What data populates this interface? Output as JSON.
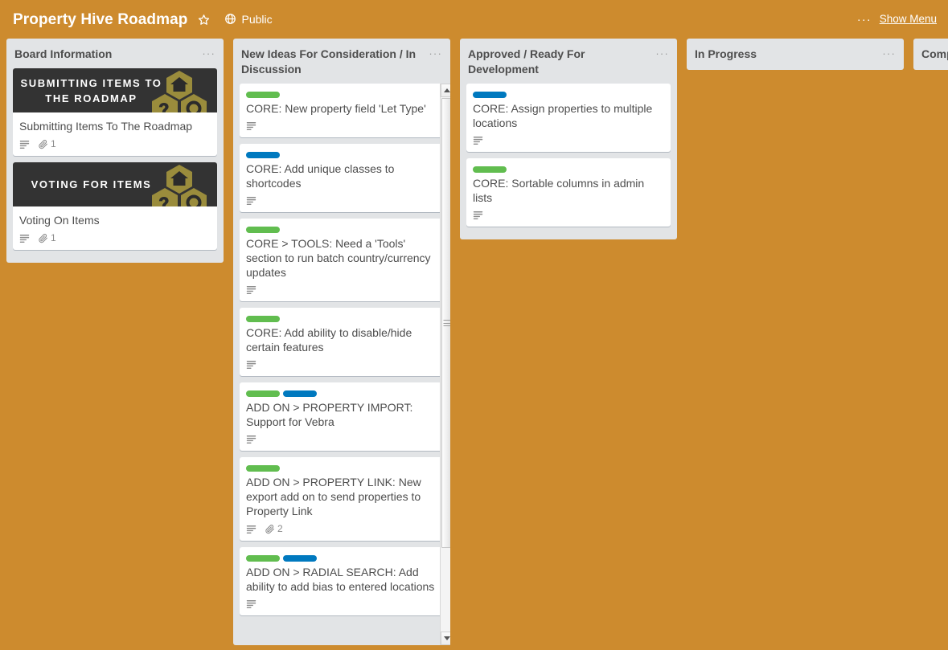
{
  "header": {
    "board_title": "Property Hive Roadmap",
    "star_icon": "star-icon",
    "visibility_icon": "globe-icon",
    "visibility_label": "Public",
    "more_dots": "···",
    "show_menu_label": "Show Menu"
  },
  "colors": {
    "board_background": "#cd8b2e",
    "list_background": "#e2e4e6",
    "card_background": "#ffffff",
    "label_green": "#61bd4f",
    "label_blue": "#0079bf",
    "cover_background": "#333333",
    "logo_gold": "#9a8c3c",
    "text_primary": "#4d4d4d"
  },
  "lists": [
    {
      "title": "Board Information",
      "menu_dots": "···",
      "scrollable": false,
      "cards": [
        {
          "cover": {
            "text": "SUBMITTING ITEMS TO THE ROADMAP",
            "logo": "property-hive-hex-logo"
          },
          "labels": [],
          "title": "Submitting Items To The Roadmap",
          "badges": {
            "description": true,
            "attachments": "1"
          }
        },
        {
          "cover": {
            "text": "VOTING FOR ITEMS",
            "logo": "property-hive-hex-logo"
          },
          "labels": [],
          "title": "Voting On Items",
          "badges": {
            "description": true,
            "attachments": "1"
          }
        }
      ]
    },
    {
      "title": "New Ideas For Consideration / In Discussion",
      "menu_dots": "···",
      "scrollable": true,
      "cards": [
        {
          "labels": [
            "green"
          ],
          "title": "CORE: New property field 'Let Type'",
          "badges": {
            "description": true,
            "attachments": null
          }
        },
        {
          "labels": [
            "blue"
          ],
          "title": "CORE: Add unique classes to shortcodes",
          "badges": {
            "description": true,
            "attachments": null
          }
        },
        {
          "labels": [
            "green"
          ],
          "title": "CORE > TOOLS: Need a 'Tools' section to run batch country/currency updates",
          "badges": {
            "description": true,
            "attachments": null
          }
        },
        {
          "labels": [
            "green"
          ],
          "title": "CORE: Add ability to disable/hide certain features",
          "badges": {
            "description": true,
            "attachments": null
          }
        },
        {
          "labels": [
            "green",
            "blue"
          ],
          "title": "ADD ON > PROPERTY IMPORT: Support for Vebra",
          "badges": {
            "description": true,
            "attachments": null
          }
        },
        {
          "labels": [
            "green"
          ],
          "title": "ADD ON > PROPERTY LINK: New export add on to send properties to Property Link",
          "badges": {
            "description": true,
            "attachments": "2"
          }
        },
        {
          "labels": [
            "green",
            "blue"
          ],
          "title": "ADD ON > RADIAL SEARCH: Add ability to add bias to entered locations",
          "badges": {
            "description": true,
            "attachments": null
          }
        }
      ]
    },
    {
      "title": "Approved / Ready For Development",
      "menu_dots": "···",
      "scrollable": false,
      "cards": [
        {
          "labels": [
            "blue"
          ],
          "title": "CORE: Assign properties to multiple locations",
          "badges": {
            "description": true,
            "attachments": null
          }
        },
        {
          "labels": [
            "green"
          ],
          "title": "CORE: Sortable columns in admin lists",
          "badges": {
            "description": true,
            "attachments": null
          }
        }
      ]
    },
    {
      "title": "In Progress",
      "menu_dots": "···",
      "scrollable": false,
      "cards": []
    },
    {
      "title": "Completed",
      "menu_dots": "···",
      "scrollable": false,
      "cards": []
    }
  ]
}
